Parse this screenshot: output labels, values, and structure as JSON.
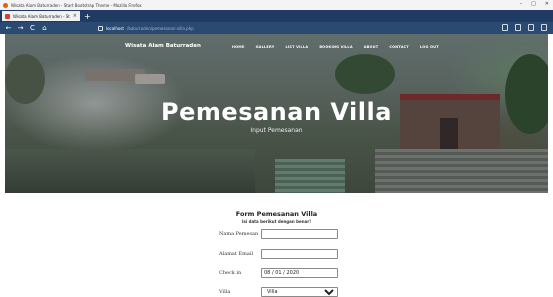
{
  "window": {
    "title": "Wisata Alam Baturraden - Start Bootstrap Theme - Mozilla Firefox",
    "controls": [
      "–",
      "□",
      "✕"
    ]
  },
  "browser": {
    "tab_label": "Wisata Alam Baturraden - Sta",
    "tab_close": "×",
    "new_tab": "+",
    "back": "←",
    "forward": "→",
    "reload": "C",
    "home": "⌂",
    "url_host": "localhost",
    "url_path": "/baturraden/pemesanan-villa.php"
  },
  "site": {
    "brand": "Wisata Alam Baturraden",
    "menu": [
      "HOME",
      "GALLERY",
      "LIST VILLA",
      "BOOKING VILLA",
      "ABOUT",
      "CONTACT",
      "LOG OUT"
    ],
    "hero_title": "Pemesanan Villa",
    "hero_subtitle": "Input Pemesanan"
  },
  "form": {
    "title": "Form Pemesanan Villa",
    "hint": "Isi data berikut dengan benar!",
    "fields": [
      {
        "label": "Nama Pemesan",
        "value": ""
      },
      {
        "label": "Alamat Email",
        "value": ""
      },
      {
        "label": "Check in",
        "value": "08 / 01 / 2020"
      },
      {
        "label": "Villa",
        "value": "Villa"
      }
    ]
  },
  "colors": {
    "tabstrip": "#1f3b63",
    "navbar": "#2a4a72"
  }
}
